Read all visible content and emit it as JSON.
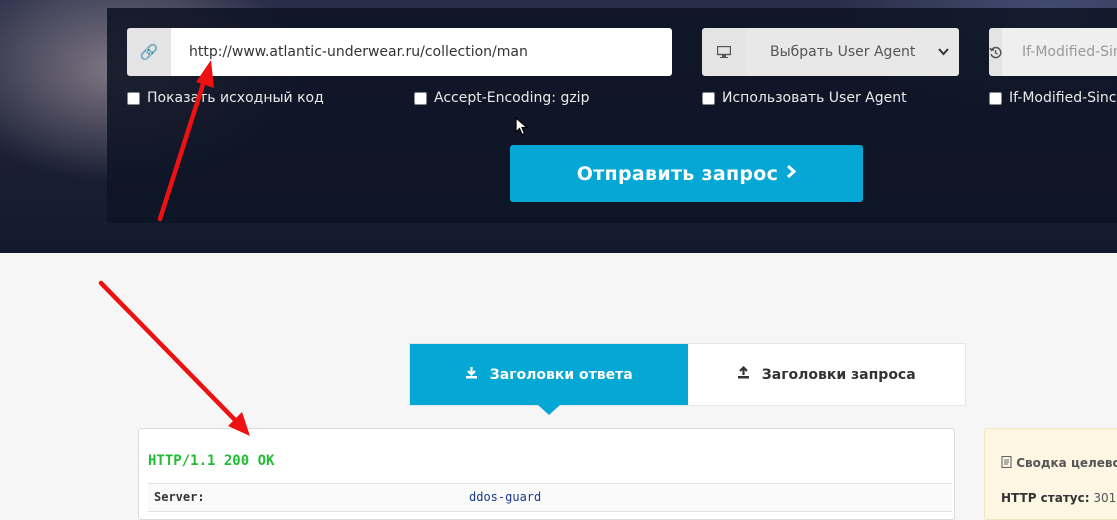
{
  "form": {
    "url_value": "http://www.atlantic-underwear.ru/collection/man",
    "user_agent_select": "Выбрать User Agent",
    "if_modified_placeholder": "If-Modified-Since",
    "checkboxes": [
      {
        "label": "Показать исходный код",
        "checked": false
      },
      {
        "label": "Accept-Encoding: gzip",
        "checked": false
      },
      {
        "label": "Использовать User Agent",
        "checked": false
      },
      {
        "label": "If-Modified-Since",
        "checked": false
      }
    ],
    "submit_label": "Отправить запрос"
  },
  "tabs": [
    {
      "label": "Заголовки ответа",
      "active": true
    },
    {
      "label": "Заголовки запроса",
      "active": false
    }
  ],
  "response": {
    "status_line": "HTTP/1.1 200 OK",
    "headers": [
      {
        "key": "Server:",
        "value": "ddos-guard"
      }
    ]
  },
  "summary": {
    "title": "Сводка целевой",
    "status_label": "HTTP статус:",
    "status_value": "301"
  },
  "colors": {
    "accent": "#05a7d4",
    "status_ok": "#22bb33",
    "annotation_arrow": "#ee1111"
  }
}
